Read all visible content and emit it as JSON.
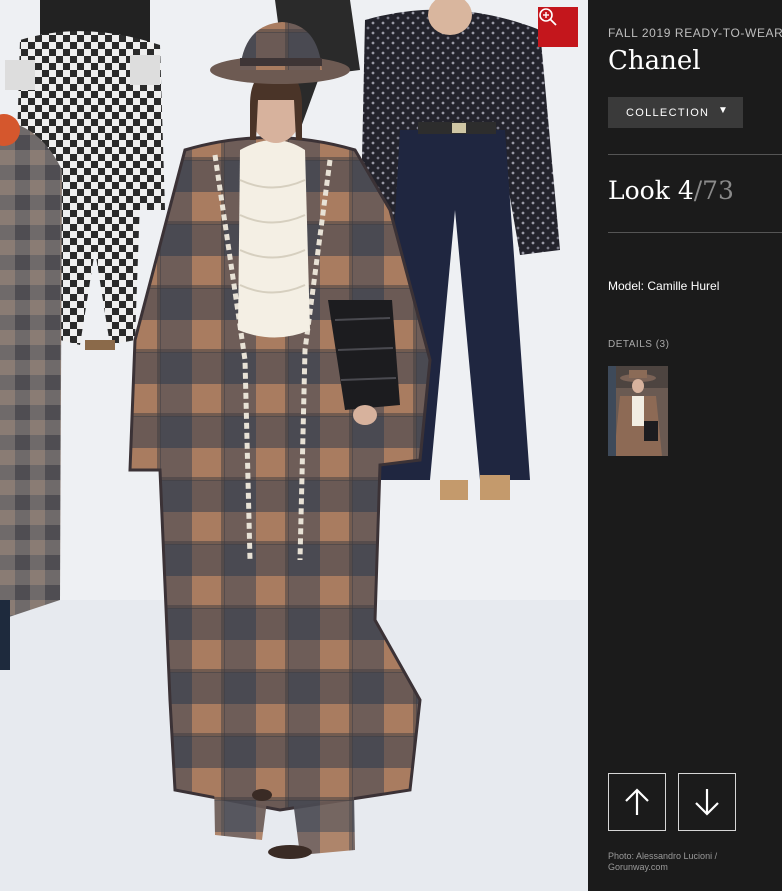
{
  "season": "FALL 2019 READY-TO-WEAR",
  "designer": "Chanel",
  "collection_button": {
    "label": "COLLECTION",
    "caret": "▼"
  },
  "look": {
    "prefix": "Look ",
    "number": "4",
    "total": "/73"
  },
  "model": "Model: Camille Hurel",
  "details_label": "DETAILS (3)",
  "photo_credit": "Photo: Alessandro Lucioni / Gorunway.com",
  "icons": {
    "zoom": "zoom-in-icon",
    "previous": "arrow-up-icon",
    "next": "arrow-down-icon"
  },
  "colors": {
    "sidebar_bg": "#1b1b1b",
    "zoom_button": "#c4161c",
    "collection_button_bg": "#3a3a3a",
    "look_total": "#8a8a8a"
  }
}
